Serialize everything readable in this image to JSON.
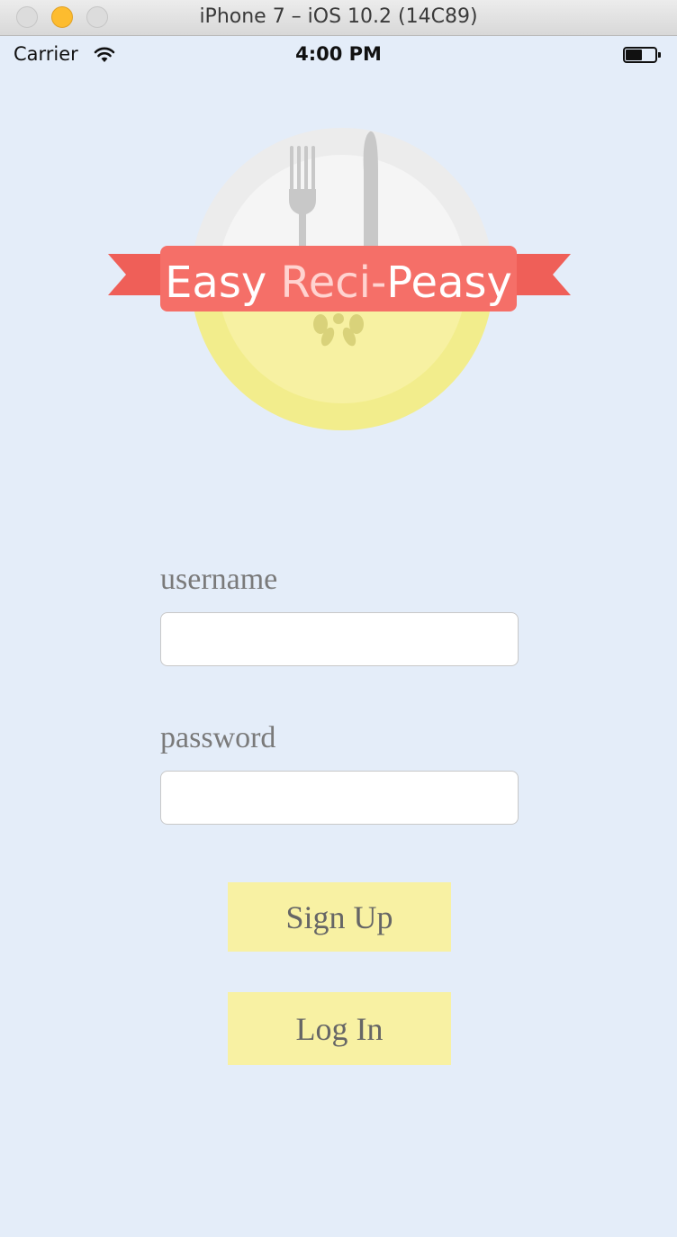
{
  "window": {
    "title": "iPhone 7 – iOS 10.2 (14C89)"
  },
  "status_bar": {
    "carrier": "Carrier",
    "time": "4:00 PM",
    "battery_level": 0.55
  },
  "logo": {
    "word1": "Easy",
    "word2": "Reci-",
    "word3": "Peasy"
  },
  "form": {
    "username_label": "username",
    "username_value": "",
    "password_label": "password",
    "password_value": ""
  },
  "buttons": {
    "sign_up": "Sign Up",
    "log_in": "Log In"
  },
  "colors": {
    "background": "#e4edf9",
    "ribbon": "#f56f68",
    "button": "#f8f1a3",
    "plate_top": "#f0f0f0",
    "plate_bottom": "#f6f0a0",
    "cutlery": "#c8c8c8"
  }
}
